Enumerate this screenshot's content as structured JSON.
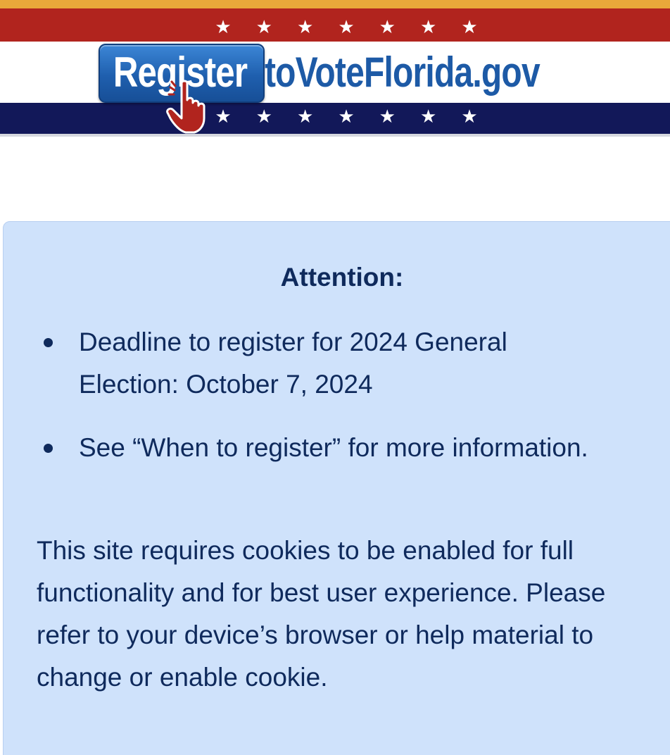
{
  "header": {
    "logo_button_text": "Register",
    "logo_domain_text": "toVoteFlorida.gov",
    "stars_top": [
      "★",
      "★",
      "★",
      "★",
      "★",
      "★",
      "★"
    ],
    "stars_bottom": [
      "★",
      "★",
      "★",
      "★",
      "★",
      "★",
      "★"
    ],
    "colors": {
      "gold": "#e9a83a",
      "red": "#b1241e",
      "navy": "#121859",
      "logo_blue": "#1d5aa6"
    },
    "hand_icon": "pointing-hand-cursor-icon"
  },
  "notice": {
    "title": "Attention:",
    "bullets": [
      "Deadline to register for 2024 General Election: October 7, 2024",
      "See “When to register” for more information."
    ],
    "cookie_message": "This site requires cookies to be enabled for full functionality and for best user experience. Please refer to your device’s browser or help material to change or enable cookie.",
    "colors": {
      "background": "#cfe2fb",
      "text": "#0f2a5c"
    }
  }
}
